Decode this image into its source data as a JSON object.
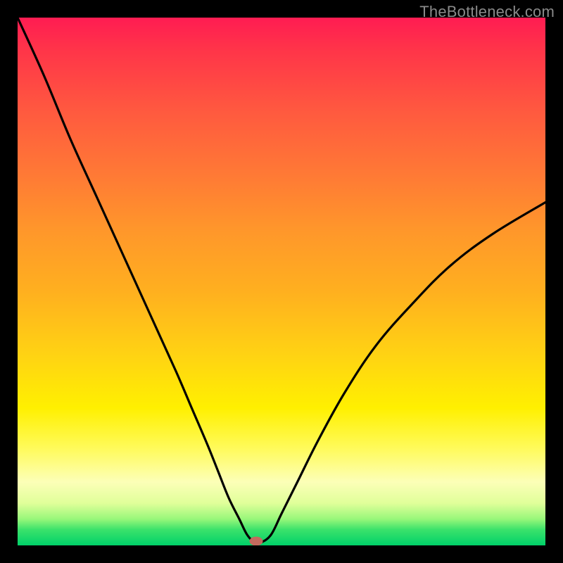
{
  "watermark": "TheBottleneck.com",
  "chart_data": {
    "type": "line",
    "title": "",
    "xlabel": "",
    "ylabel": "",
    "xlim": [
      0,
      100
    ],
    "ylim": [
      0,
      100
    ],
    "series": [
      {
        "name": "bottleneck-curve",
        "x": [
          0,
          5,
          10,
          15,
          20,
          25,
          30,
          33,
          36,
          38,
          40,
          42,
          43.5,
          45,
          46,
          48,
          50,
          53,
          57,
          62,
          68,
          75,
          82,
          90,
          100
        ],
        "values": [
          100,
          89,
          77,
          66,
          55,
          44,
          33,
          26,
          19,
          14,
          9,
          5,
          2,
          0.5,
          0.5,
          2,
          6,
          12,
          20,
          29,
          38,
          46,
          53,
          59,
          65
        ]
      }
    ],
    "annotations": [
      {
        "name": "valley-marker",
        "x": 45.2,
        "y": 0.8
      }
    ],
    "grid": false,
    "legend": false
  }
}
